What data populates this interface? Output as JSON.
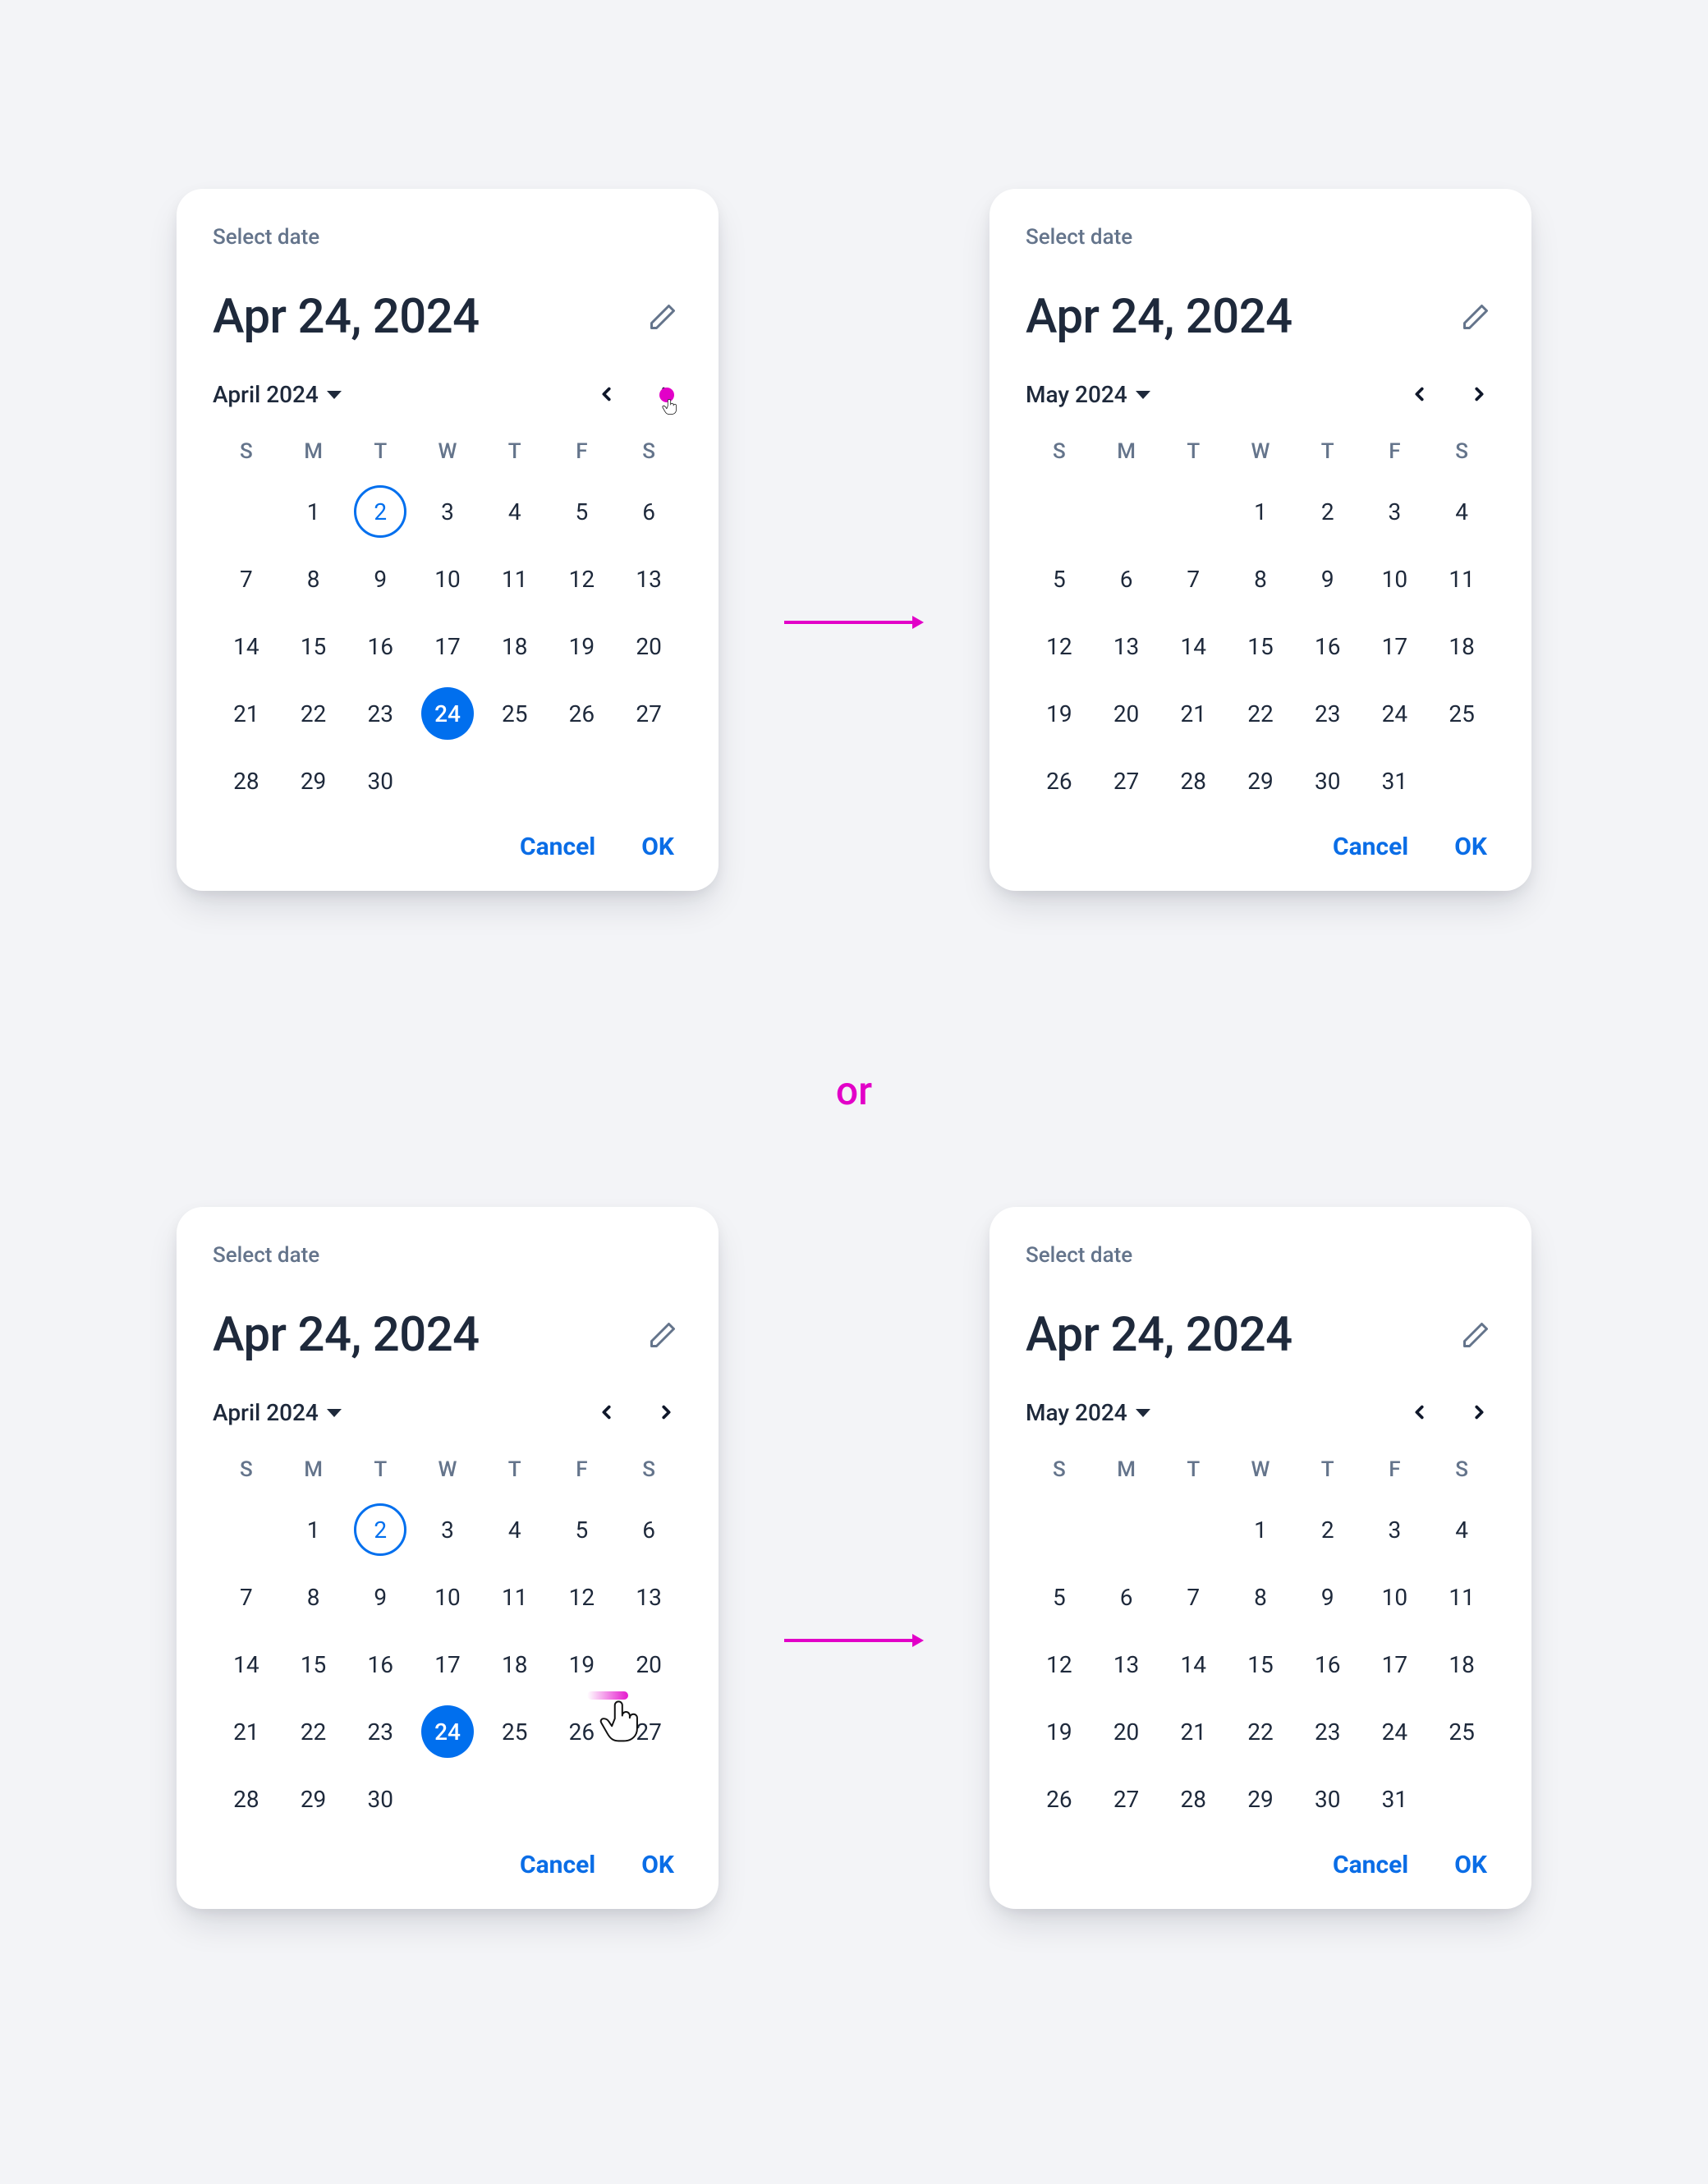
{
  "common": {
    "label": "Select date",
    "headline": "Apr 24, 2024",
    "cancel": "Cancel",
    "ok": "OK",
    "dow": [
      "S",
      "M",
      "T",
      "W",
      "T",
      "F",
      "S"
    ]
  },
  "orLabel": "or",
  "months": {
    "apr": {
      "title": "April 2024",
      "leading_blanks": 1,
      "days": 30,
      "today": 2,
      "selected": 24
    },
    "may": {
      "title": "May 2024",
      "leading_blanks": 3,
      "days": 31,
      "today": null,
      "selected": null
    }
  },
  "cards": [
    {
      "id": "c1",
      "month": "apr",
      "touchOnNext": true
    },
    {
      "id": "c2",
      "month": "may"
    },
    {
      "id": "c3",
      "month": "apr",
      "swipeOnGrid": true
    },
    {
      "id": "c4",
      "month": "may"
    }
  ]
}
